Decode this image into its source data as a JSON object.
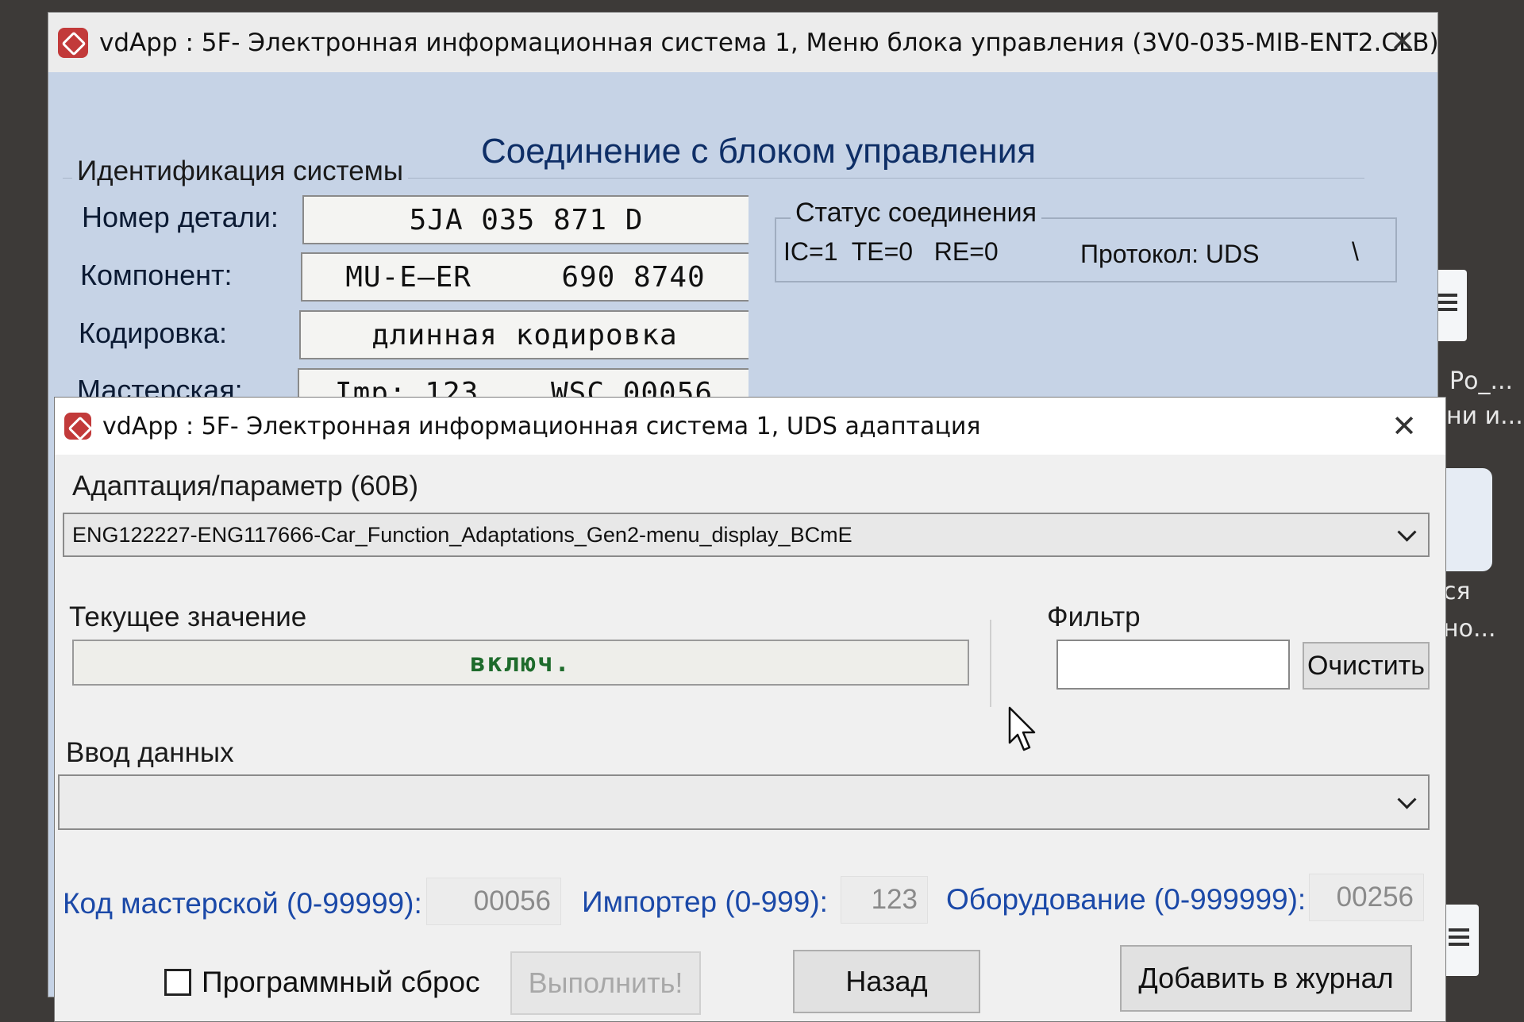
{
  "desktop": {
    "right_labels": [
      "Ро_...",
      "ни и...",
      "ся",
      "но..."
    ]
  },
  "main_window": {
    "title": "vdApp : 5F- Электронная информационная система 1,  Меню блока управления (3V0-035-MIB-ENT2.CLB)",
    "heading": "Соединение с блоком управления",
    "ident_group": "Идентификация системы",
    "fields": [
      {
        "label": "Номер детали:",
        "value": "5JA 035 871 D"
      },
      {
        "label": "Компонент:",
        "value": "MU-E—ER     690 8740"
      },
      {
        "label": "Кодировка:",
        "value": "длинная кодировка"
      },
      {
        "label": "Мастерская:",
        "value": "Imp: 123    WSC 00056"
      }
    ],
    "status": {
      "title": "Статус соединения",
      "counters": "IC=1  TE=0   RE=0",
      "protocol": "Протокол: UDS",
      "spinner": "\\"
    }
  },
  "dialog": {
    "title": "vdApp : 5F- Электронная информационная система 1,  UDS адаптация",
    "param_label": "Адаптация/параметр (60B)",
    "param_value": "ENG122227-ENG117666-Car_Function_Adaptations_Gen2-menu_display_BCmE",
    "current_label": "Текущее значение",
    "current_value": "включ.",
    "filter_label": "Фильтр",
    "filter_value": "",
    "clear_button": "Очистить",
    "input_label": "Ввод данных",
    "input_value": "",
    "workshop_label": "Код мастерской (0-99999):",
    "workshop_value": "00056",
    "importer_label": "Импортер (0-999):",
    "importer_value": "123",
    "equipment_label": "Оборудование (0-999999):",
    "equipment_value": "00256",
    "soft_reset_label": "Программный сброс",
    "execute_button": "Выполнить!",
    "back_button": "Назад",
    "log_button": "Добавить в журнал"
  }
}
